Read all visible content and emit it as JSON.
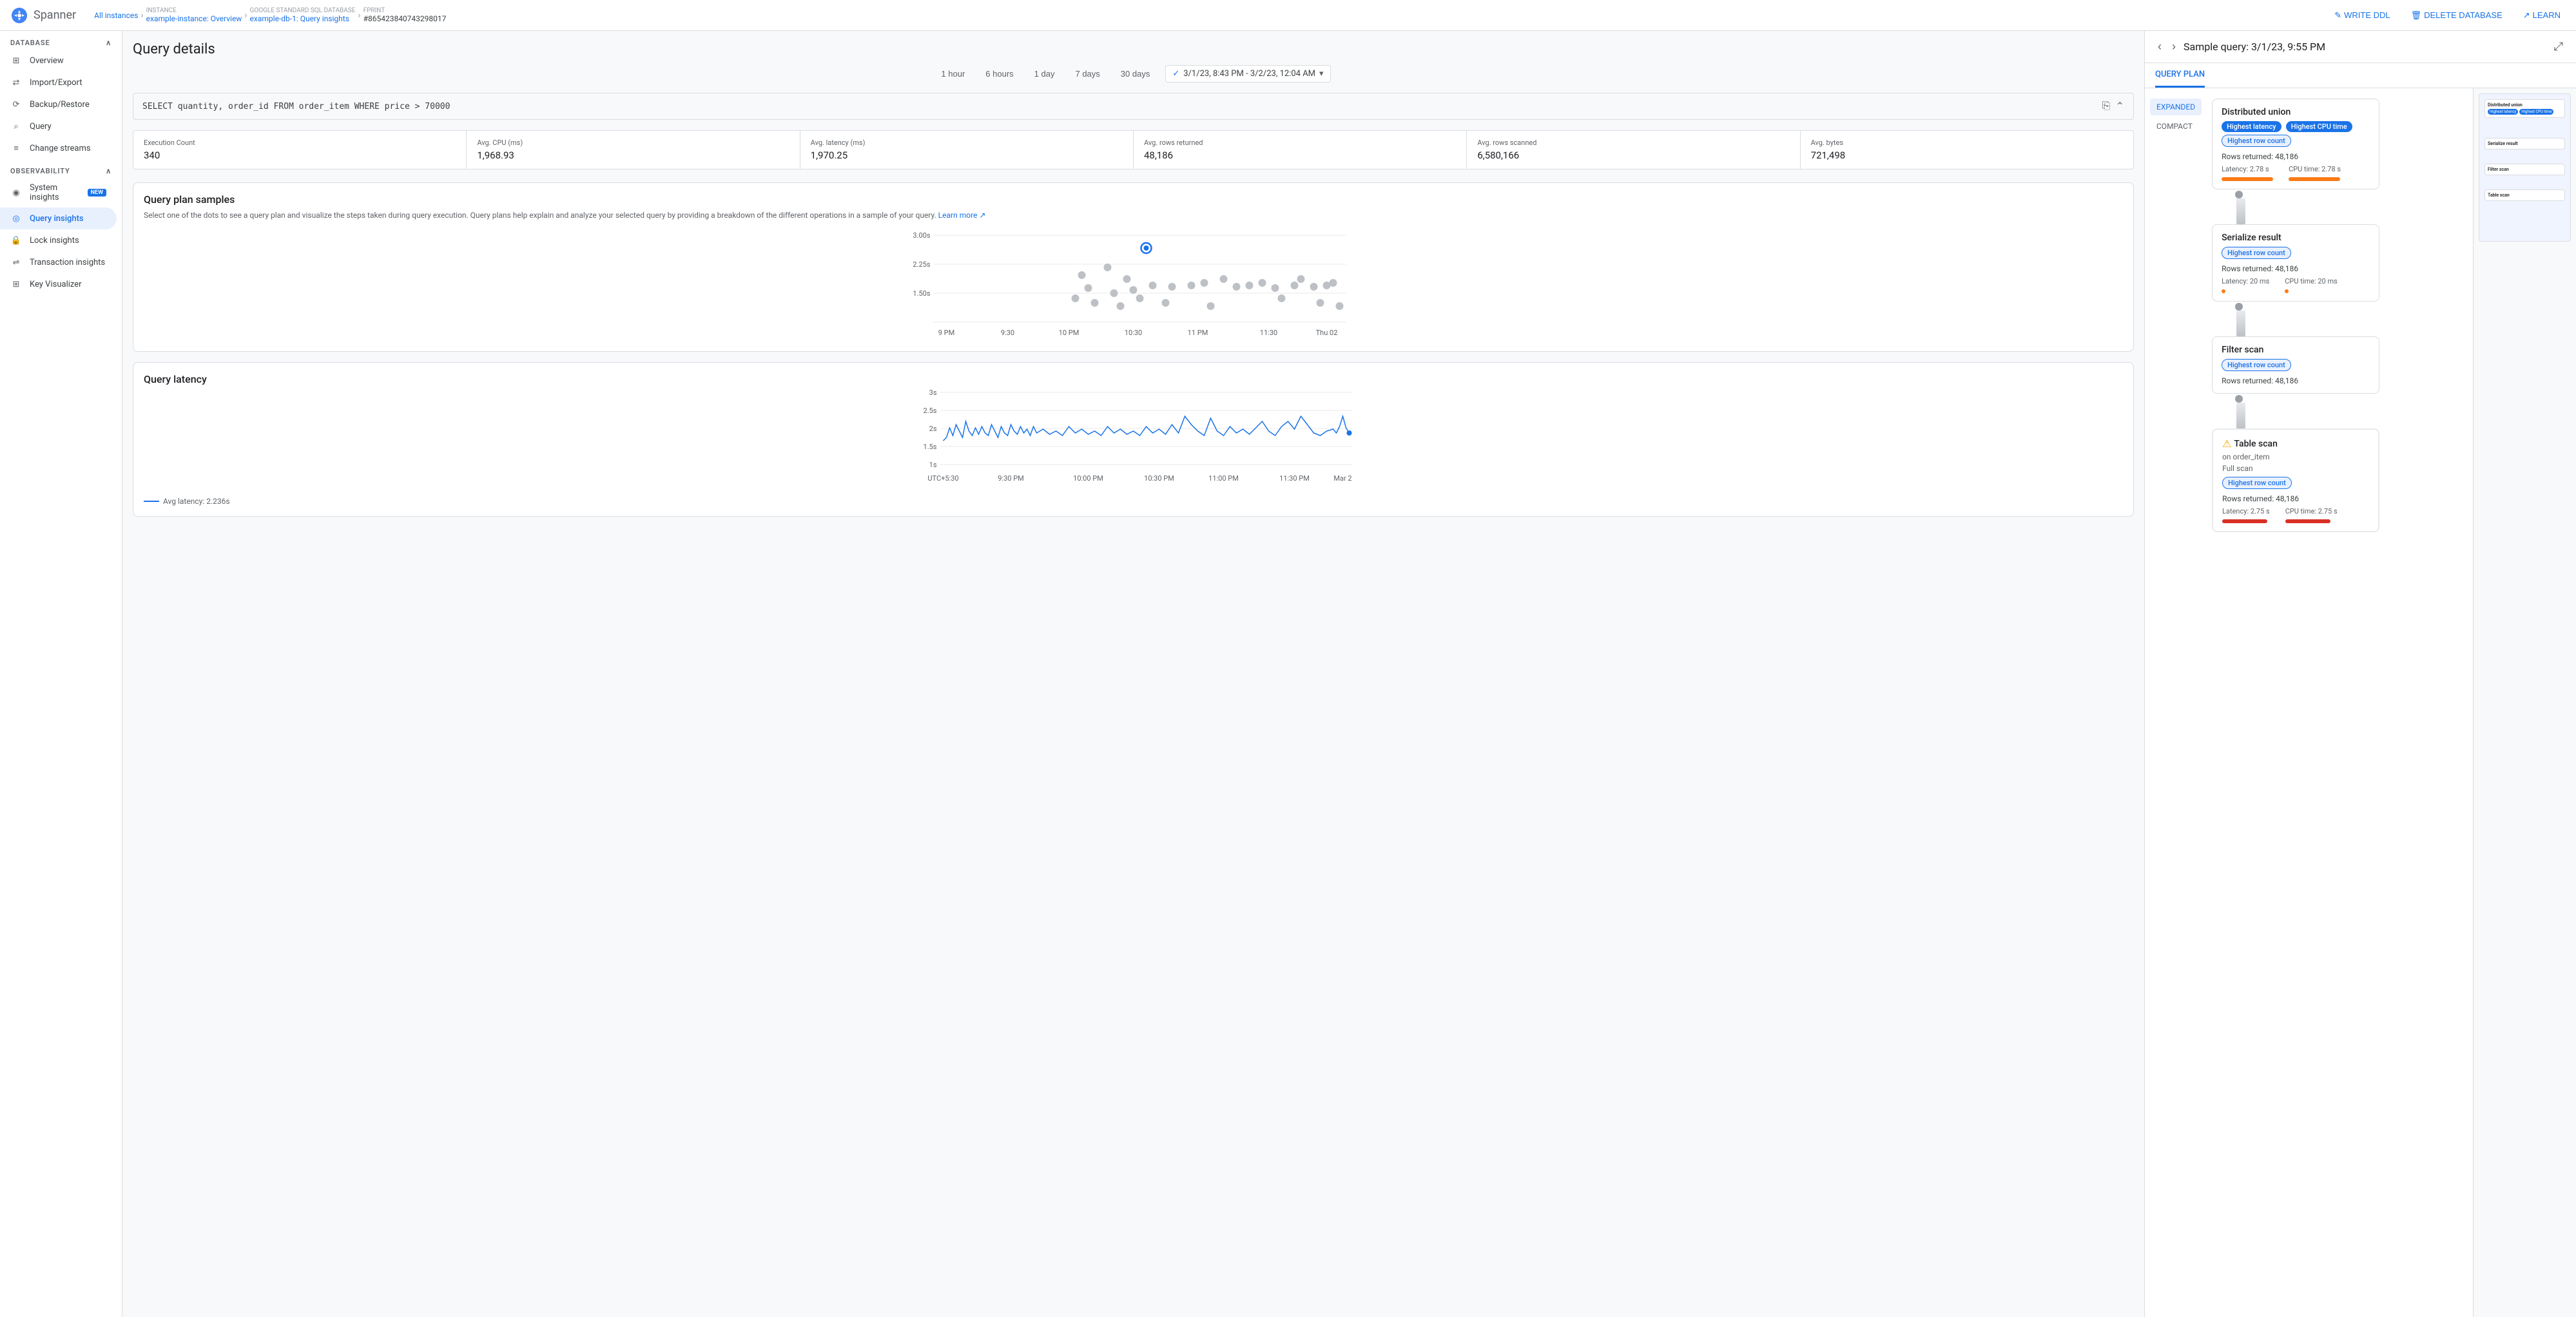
{
  "app": {
    "name": "Spanner"
  },
  "breadcrumb": {
    "items": [
      {
        "label": "All instances",
        "href": "#"
      },
      {
        "label": "INSTANCE",
        "sub": "example-instance: Overview",
        "href": "#"
      },
      {
        "label": "GOOGLE STANDARD SQL DATABASE",
        "sub": "example-db-1: Query insights",
        "href": "#"
      },
      {
        "label": "FPRINT",
        "sub": "#865423840743298017"
      }
    ]
  },
  "topbar_actions": [
    {
      "label": "WRITE DDL",
      "icon": "pencil-icon"
    },
    {
      "label": "DELETE DATABASE",
      "icon": "trash-icon"
    },
    {
      "label": "LEARN",
      "icon": "learn-icon"
    }
  ],
  "sidebar": {
    "database_section": "DATABASE",
    "db_items": [
      {
        "label": "Overview",
        "icon": "grid-icon",
        "active": false
      },
      {
        "label": "Import/Export",
        "icon": "swap-icon",
        "active": false
      },
      {
        "label": "Backup/Restore",
        "icon": "backup-icon",
        "active": false
      },
      {
        "label": "Query",
        "icon": "query-icon",
        "active": false
      },
      {
        "label": "Change streams",
        "icon": "streams-icon",
        "active": false
      }
    ],
    "observability_section": "OBSERVABILITY",
    "obs_items": [
      {
        "label": "System insights",
        "icon": "insights-icon",
        "active": false,
        "badge": "NEW"
      },
      {
        "label": "Query insights",
        "icon": "query-insights-icon",
        "active": true
      },
      {
        "label": "Lock insights",
        "icon": "lock-icon",
        "active": false
      },
      {
        "label": "Transaction insights",
        "icon": "transaction-icon",
        "active": false
      },
      {
        "label": "Key Visualizer",
        "icon": "key-icon",
        "active": false
      }
    ]
  },
  "page": {
    "title": "Query details"
  },
  "time_filters": {
    "options": [
      "1 hour",
      "6 hours",
      "1 day",
      "7 days",
      "30 days"
    ],
    "selected_range": "3/1/23, 8:43 PM - 3/2/23, 12:04 AM"
  },
  "sql": {
    "query": "SELECT quantity, order_id FROM order_item WHERE price > 70000"
  },
  "stats": [
    {
      "label": "Execution Count",
      "value": "340"
    },
    {
      "label": "Avg. CPU (ms)",
      "value": "1,968.93"
    },
    {
      "label": "Avg. latency (ms)",
      "value": "1,970.25"
    },
    {
      "label": "Avg. rows returned",
      "value": "48,186"
    },
    {
      "label": "Avg. rows scanned",
      "value": "6,580,166"
    },
    {
      "label": "Avg. bytes",
      "value": "721,498"
    }
  ],
  "query_plan_samples": {
    "title": "Query plan samples",
    "description": "Select one of the dots to see a query plan and visualize the steps taken during query execution. Query plans help explain and analyze your selected query by providing a breakdown of the different operations in a sample of your query.",
    "learn_more": "Learn more",
    "x_labels": [
      "9 PM",
      "9:30",
      "10 PM",
      "10:30",
      "11 PM",
      "11:30",
      "Thu 02"
    ],
    "y_labels": [
      "3.00s",
      "2.25s",
      "1.50s"
    ],
    "selected_point": {
      "x": 38,
      "y": 30
    }
  },
  "query_latency": {
    "title": "Query latency",
    "x_labels": [
      "UTC+5:30",
      "9:30 PM",
      "10:00 PM",
      "10:30 PM",
      "11:00 PM",
      "11:30 PM",
      "Mar 2"
    ],
    "y_labels": [
      "3s",
      "2.5s",
      "2s",
      "1.5s",
      "1s"
    ],
    "legend": "Avg latency: 2.236s"
  },
  "right_panel": {
    "title": "Sample query: 3/1/23, 9:55 PM",
    "tabs": [
      "QUERY PLAN"
    ],
    "active_tab": "QUERY PLAN",
    "mode_tabs": [
      "EXPANDED",
      "COMPACT"
    ],
    "active_mode": "EXPANDED",
    "nodes": [
      {
        "title": "Distributed union",
        "tags": [
          "Highest latency",
          "Highest CPU time",
          "Highest row count"
        ],
        "tag_styles": [
          "tag-blue",
          "tag-blue",
          "tag-blue-outline"
        ],
        "rows": "Rows returned: 48,186",
        "latency_label": "Latency: 2.78 s",
        "cpu_label": "CPU time: 2.78 s",
        "latency_bar_color": "bar-orange",
        "cpu_bar_color": "bar-orange",
        "warning": false
      },
      {
        "title": "Serialize result",
        "tags": [
          "Highest row count"
        ],
        "tag_styles": [
          "tag-blue-outline"
        ],
        "rows": "Rows returned: 48,186",
        "latency_label": "Latency: 20 ms",
        "cpu_label": "CPU time: 20 ms",
        "latency_bar_color": "bar-orange",
        "cpu_bar_color": "bar-orange",
        "warning": false
      },
      {
        "title": "Filter scan",
        "tags": [
          "Highest row count"
        ],
        "tag_styles": [
          "tag-blue-outline"
        ],
        "rows": "Rows returned: 48,186",
        "latency_label": "",
        "cpu_label": "",
        "warning": false
      },
      {
        "title": "Table scan",
        "subtitle": "on order_item",
        "subtitle2": "Full scan",
        "tags": [
          "Highest row count"
        ],
        "tag_styles": [
          "tag-blue-outline"
        ],
        "rows": "Rows returned: 48,186",
        "latency_label": "Latency: 2.75 s",
        "cpu_label": "CPU time: 2.75 s",
        "latency_bar_color": "bar-red",
        "cpu_bar_color": "bar-red",
        "warning": true
      }
    ]
  }
}
